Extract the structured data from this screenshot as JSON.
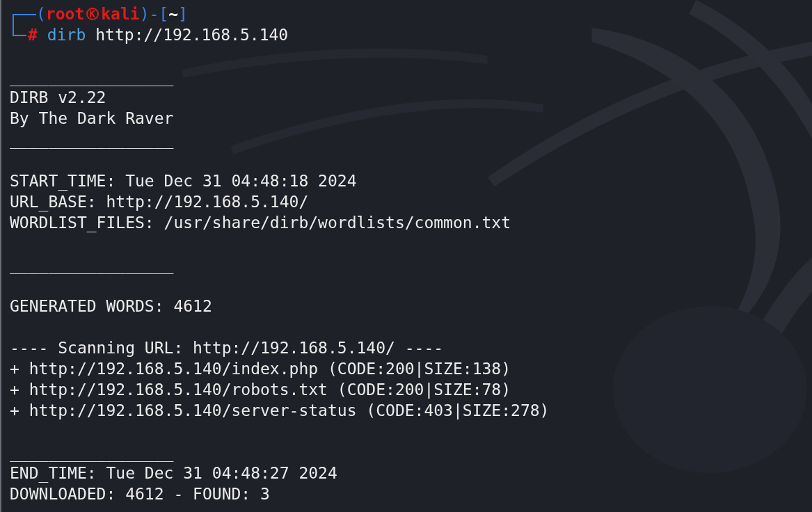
{
  "prompt": {
    "open": "(",
    "close_host": ")-[",
    "close_dir": "]",
    "user": "root",
    "host": "kali",
    "dir": "~",
    "command": "dirb",
    "args": "http://192.168.5.140",
    "symbol": "#"
  },
  "output": [
    {
      "kind": "blank"
    },
    {
      "kind": "rule",
      "text": "_________________"
    },
    {
      "kind": "text",
      "text": "DIRB v2.22"
    },
    {
      "kind": "text",
      "text": "By The Dark Raver"
    },
    {
      "kind": "rule",
      "text": "_________________"
    },
    {
      "kind": "blank"
    },
    {
      "kind": "text",
      "text": "START_TIME: Tue Dec 31 04:48:18 2024"
    },
    {
      "kind": "text",
      "text": "URL_BASE: http://192.168.5.140/"
    },
    {
      "kind": "text",
      "text": "WORDLIST_FILES: /usr/share/dirb/wordlists/common.txt"
    },
    {
      "kind": "blank"
    },
    {
      "kind": "rule",
      "text": "_________________"
    },
    {
      "kind": "blank"
    },
    {
      "kind": "text",
      "text": "GENERATED WORDS: 4612"
    },
    {
      "kind": "blank"
    },
    {
      "kind": "text",
      "text": "---- Scanning URL: http://192.168.5.140/ ----"
    },
    {
      "kind": "text",
      "text": "+ http://192.168.5.140/index.php (CODE:200|SIZE:138)"
    },
    {
      "kind": "text",
      "text": "+ http://192.168.5.140/robots.txt (CODE:200|SIZE:78)"
    },
    {
      "kind": "text",
      "text": "+ http://192.168.5.140/server-status (CODE:403|SIZE:278)"
    },
    {
      "kind": "blank"
    },
    {
      "kind": "rule",
      "text": "_________________"
    },
    {
      "kind": "text",
      "text": "END_TIME: Tue Dec 31 04:48:27 2024"
    },
    {
      "kind": "text",
      "text": "DOWNLOADED: 4612 - FOUND: 3"
    }
  ]
}
